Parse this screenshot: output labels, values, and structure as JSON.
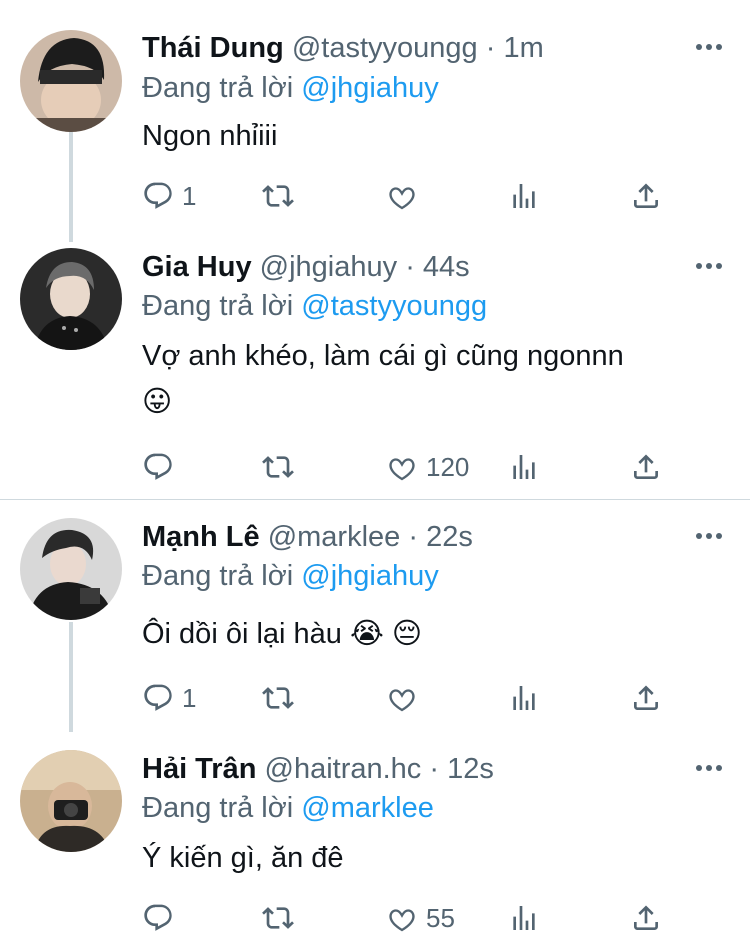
{
  "reply_prefix": "Đang trả lời",
  "colors": {
    "accent": "#1d9bf0",
    "muted": "#536471",
    "text": "#0f1419",
    "line": "#cfd9de"
  },
  "tweets": [
    {
      "name": "Thái Dung",
      "handle": "@tastyyoungg",
      "dot": "·",
      "time": "1m",
      "reply_to": "@jhgiahuy",
      "text": "Ngon nhỉiii",
      "emoji": "",
      "replies": "1",
      "retweets": "",
      "likes": "",
      "icons": [
        "reply-icon",
        "retweet-icon",
        "like-icon",
        "analytics-icon",
        "share-icon"
      ]
    },
    {
      "name": "Gia Huy",
      "handle": "@jhgiahuy",
      "dot": "·",
      "time": "44s",
      "reply_to": "@tastyyoungg",
      "text": "Vợ anh khéo, làm cái gì cũng ngonnn",
      "emoji": "😛",
      "replies": "",
      "retweets": "",
      "likes": "120"
    },
    {
      "name": "Mạnh Lê",
      "handle": "@marklee",
      "dot": "·",
      "time": "22s",
      "reply_to": "@jhgiahuy",
      "text": "Ôi dồi ôi lại hàu 😭 😔",
      "emoji": "",
      "replies": "1",
      "retweets": "",
      "likes": ""
    },
    {
      "name": "Hải Trân",
      "handle": "@haitran.hc",
      "dot": "·",
      "time": "12s",
      "reply_to": "@marklee",
      "text": "Ý kiến gì, ăn đê",
      "emoji": "",
      "replies": "",
      "retweets": "",
      "likes": "55"
    }
  ]
}
